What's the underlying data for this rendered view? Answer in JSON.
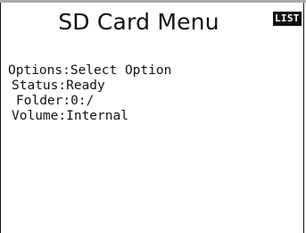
{
  "screen": {
    "title": "SD Card Menu",
    "badge": "LIST"
  },
  "fields": {
    "options": {
      "label": "Options:",
      "value": "Select Option"
    },
    "status": {
      "label": "Status:",
      "value": "Ready"
    },
    "folder": {
      "label": "Folder:",
      "value": "0:/"
    },
    "volume": {
      "label": "Volume:",
      "value": "Internal"
    }
  }
}
